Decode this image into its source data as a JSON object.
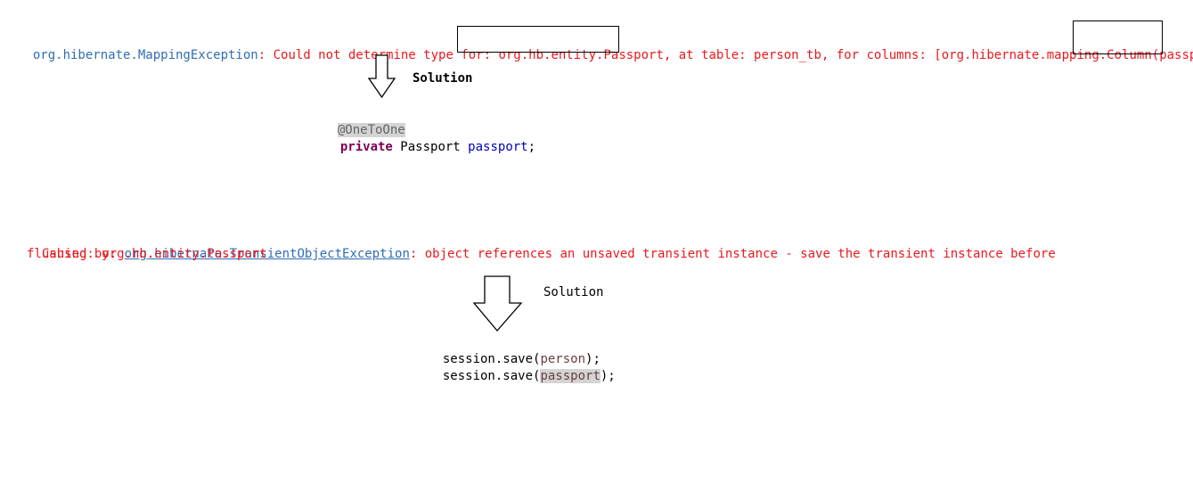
{
  "error1": {
    "exception_class": "org.hibernate.MappingException",
    "message_prefix": ": Could not determine type for: ",
    "entity": "org.hb.entity.Passport",
    "message_middle": ", at table: person_tb, for columns: [org.hibernate.mapping.Column",
    "column": "(passport)]"
  },
  "solution1": {
    "label": "Solution",
    "annotation": "@OneToOne",
    "keyword": "private",
    "type": " Passport ",
    "field": "passport",
    "terminator": ";"
  },
  "error2": {
    "prefix": "Caused by: ",
    "exception_class": "org.hibernate.TransientObjectException",
    "message": ": object references an unsaved transient instance - save the transient instance before",
    "line2": "flushing: org.hb.entity.Passport"
  },
  "solution2": {
    "label": "Solution",
    "line1_prefix": "session.save(",
    "line1_arg": "person",
    "line1_suffix": ");",
    "line2_prefix": "session.save(",
    "line2_arg": "passport",
    "line2_suffix": ");"
  }
}
